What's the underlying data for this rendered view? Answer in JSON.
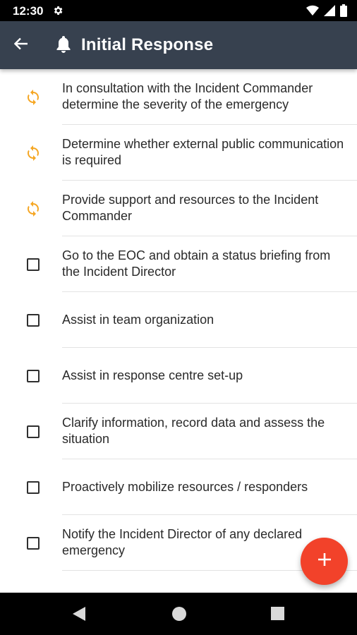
{
  "status_bar": {
    "time": "12:30"
  },
  "app_bar": {
    "title": "Initial Response"
  },
  "colors": {
    "app_bar": "#37414f",
    "accent_sync": "#f5a623",
    "fab": "#f2422a"
  },
  "tasks": [
    {
      "state": "sync",
      "icon": "sync-icon",
      "text": "In consultation with the Incident Commander determine the severity of the emergency"
    },
    {
      "state": "sync",
      "icon": "sync-icon",
      "text": "Determine whether external public communication is required"
    },
    {
      "state": "sync",
      "icon": "sync-icon",
      "text": "Provide support and resources to the Incident Commander"
    },
    {
      "state": "unchecked",
      "icon": "checkbox",
      "text": "Go to the EOC and obtain a status briefing from the Incident Director"
    },
    {
      "state": "unchecked",
      "icon": "checkbox",
      "text": "Assist in team organization"
    },
    {
      "state": "unchecked",
      "icon": "checkbox",
      "text": "Assist in response centre set-up"
    },
    {
      "state": "unchecked",
      "icon": "checkbox",
      "text": "Clarify information, record data and assess the situation"
    },
    {
      "state": "unchecked",
      "icon": "checkbox",
      "text": "Proactively mobilize resources / responders"
    },
    {
      "state": "unchecked",
      "icon": "checkbox",
      "text": "Notify the Incident Director of any declared emergency"
    }
  ]
}
